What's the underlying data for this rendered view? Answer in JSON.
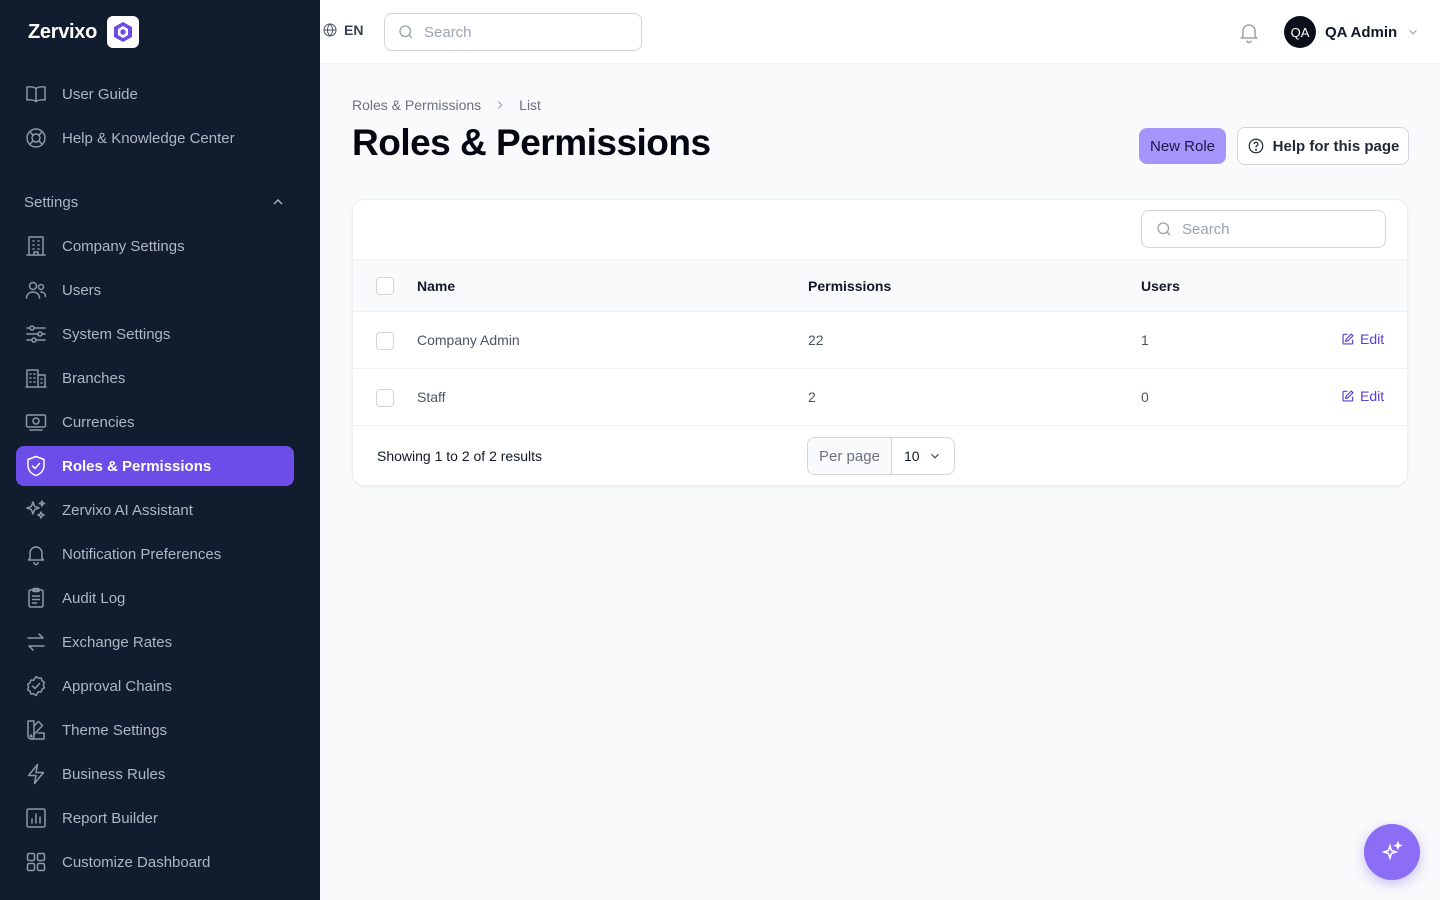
{
  "brand": {
    "name": "Zervixo",
    "accent": "#6d4de8"
  },
  "topbar": {
    "language": "EN",
    "search_placeholder": "Search",
    "user": {
      "initials": "QA",
      "name": "QA Admin"
    }
  },
  "sidebar": {
    "top_items": [
      {
        "label": "User Guide",
        "icon": "book-icon"
      },
      {
        "label": "Help & Knowledge Center",
        "icon": "lifebuoy-icon"
      }
    ],
    "group": {
      "label": "Settings",
      "expanded": true
    },
    "items": [
      {
        "label": "Company Settings",
        "icon": "building-icon"
      },
      {
        "label": "Users",
        "icon": "users-icon"
      },
      {
        "label": "System Settings",
        "icon": "sliders-icon"
      },
      {
        "label": "Branches",
        "icon": "office-icon"
      },
      {
        "label": "Currencies",
        "icon": "cash-icon"
      },
      {
        "label": "Roles & Permissions",
        "icon": "shield-check-icon",
        "active": true
      },
      {
        "label": "Zervixo AI Assistant",
        "icon": "sparkles-icon"
      },
      {
        "label": "Notification Preferences",
        "icon": "bell-icon"
      },
      {
        "label": "Audit Log",
        "icon": "clipboard-icon"
      },
      {
        "label": "Exchange Rates",
        "icon": "arrows-icon"
      },
      {
        "label": "Approval Chains",
        "icon": "check-badge-icon"
      },
      {
        "label": "Theme Settings",
        "icon": "swatch-icon"
      },
      {
        "label": "Business Rules",
        "icon": "bolt-icon"
      },
      {
        "label": "Report Builder",
        "icon": "chart-icon"
      },
      {
        "label": "Customize Dashboard",
        "icon": "grid-icon"
      }
    ]
  },
  "breadcrumb": {
    "parent": "Roles & Permissions",
    "current": "List"
  },
  "page": {
    "title": "Roles & Permissions",
    "new_button": "New Role",
    "help_button": "Help for this page"
  },
  "table": {
    "search_placeholder": "Search",
    "columns": {
      "name": "Name",
      "permissions": "Permissions",
      "users": "Users"
    },
    "rows": [
      {
        "name": "Company Admin",
        "permissions": "22",
        "users": "1",
        "action": "Edit"
      },
      {
        "name": "Staff",
        "permissions": "2",
        "users": "0",
        "action": "Edit"
      }
    ],
    "summary": "Showing 1 to 2 of 2 results",
    "per_page_label": "Per page",
    "per_page_value": "10"
  }
}
